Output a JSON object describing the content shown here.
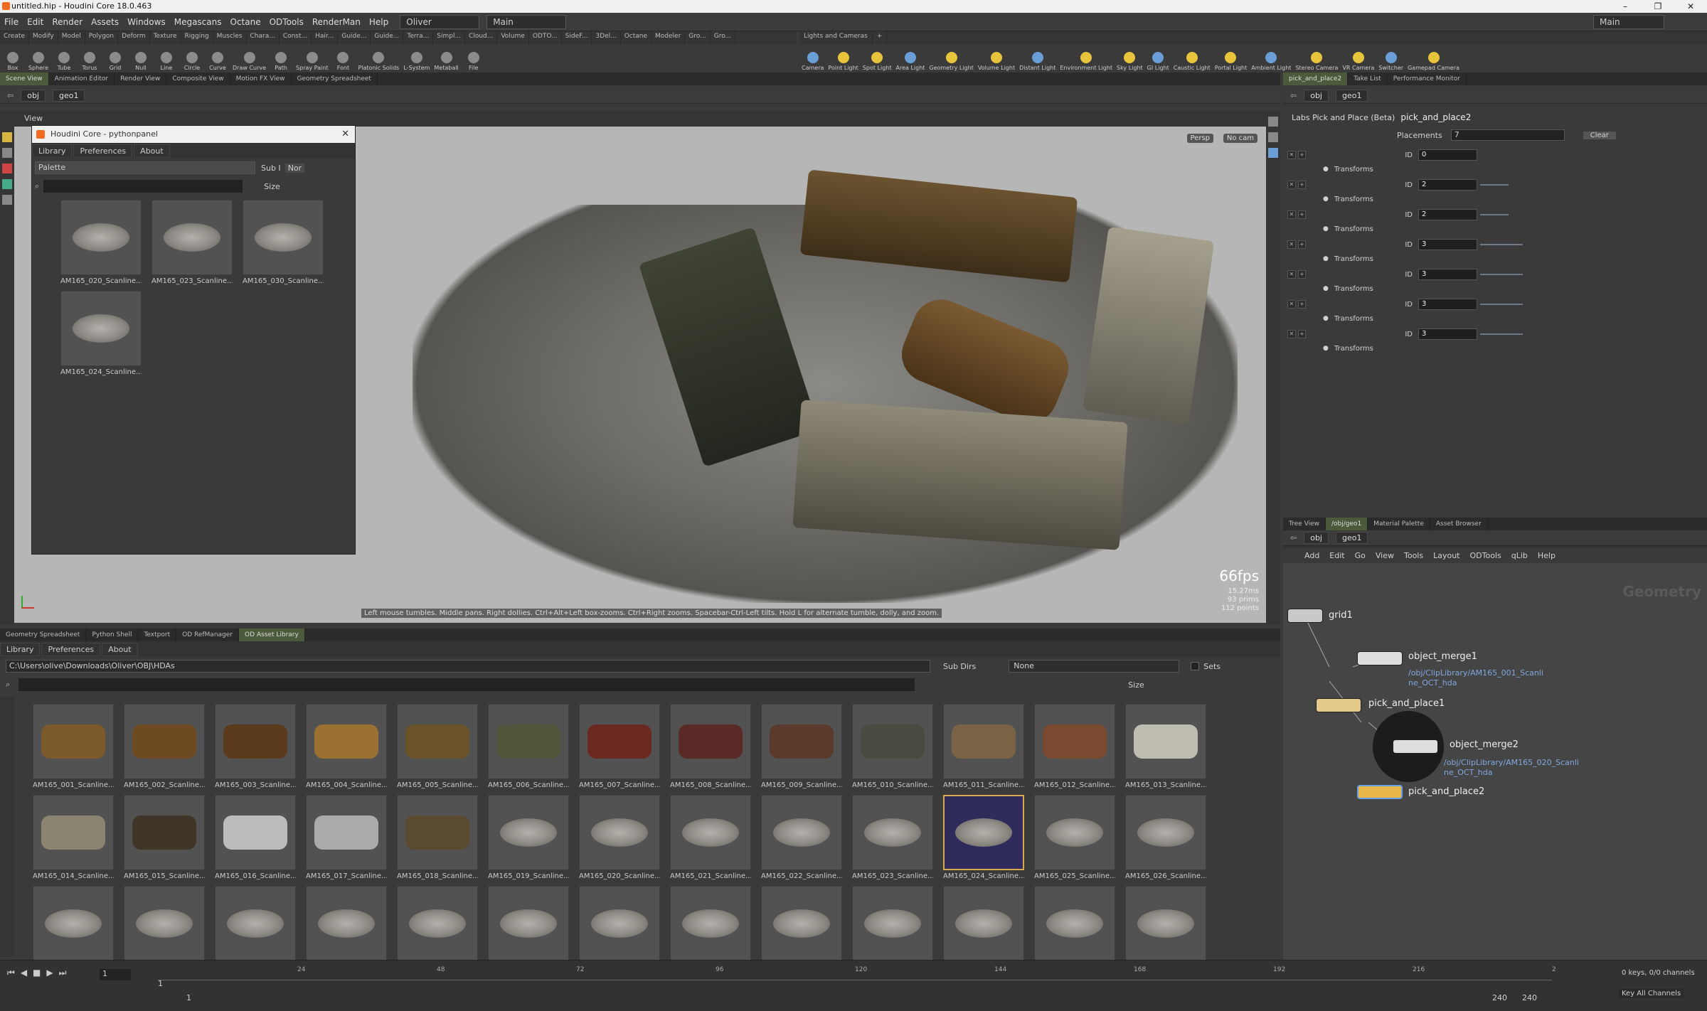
{
  "window": {
    "title": "untitled.hip - Houdini Core 18.0.463",
    "controls": [
      "–",
      "❐",
      "✕"
    ]
  },
  "menubar": {
    "items": [
      "File",
      "Edit",
      "Render",
      "Assets",
      "Windows",
      "Megascans",
      "Octane",
      "ODTools",
      "RenderMan",
      "Help"
    ],
    "desktop": "Oliver",
    "context": "Main",
    "right_context": "Main"
  },
  "shelf_tabs_left": [
    "Create",
    "Modify",
    "Model",
    "Polygon",
    "Deform",
    "Texture",
    "Rigging",
    "Muscles",
    "Chara...",
    "Const...",
    "Hair...",
    "Guide...",
    "Guide...",
    "Terra...",
    "Simpl...",
    "Cloud...",
    "Volume",
    "ODTO...",
    "SideF...",
    "3Del...",
    "Octane",
    "Modeler",
    "Gro...",
    "Gro..."
  ],
  "shelf_tabs_right": [
    "Lights and Cameras"
  ],
  "tools_left": [
    "Box",
    "Sphere",
    "Tube",
    "Torus",
    "Grid",
    "Null",
    "Line",
    "Circle",
    "Curve",
    "Draw Curve",
    "Path",
    "Spray Paint",
    "Font",
    "Platonic Solids",
    "L-System",
    "Metaball",
    "File"
  ],
  "tools_right": [
    "Camera",
    "Point Light",
    "Spot Light",
    "Area Light",
    "Geometry Light",
    "Volume Light",
    "Distant Light",
    "Environment Light",
    "Sky Light",
    "GI Light",
    "Caustic Light",
    "Portal Light",
    "Ambient Light",
    "Stereo Camera",
    "VR Camera",
    "Switcher",
    "Gamepad Camera"
  ],
  "left_pane_tabs": [
    "Scene View",
    "Animation Editor",
    "Render View",
    "Composite View",
    "Motion FX View",
    "Geometry Spreadsheet"
  ],
  "right_top_tabs": [
    "pick_and_place2",
    "Take List",
    "Performance Monitor"
  ],
  "path": {
    "obj": "obj",
    "geo": "geo1"
  },
  "viewport": {
    "label": "View",
    "persp": "Persp",
    "cam": "No cam",
    "fps": "66fps",
    "stats": [
      "15.27ms",
      "93  prims",
      "112  points"
    ],
    "help": "Left mouse tumbles. Middle pans. Right dollies. Ctrl+Alt+Left box-zooms. Ctrl+Right zooms. Spacebar-Ctrl-Left tilts. Hold L for alternate tumble, dolly, and zoom."
  },
  "python_panel": {
    "title": "Houdini Core - pythonpanel",
    "tabs": [
      "Library",
      "Preferences",
      "About"
    ],
    "palette": "Palette",
    "sub_label": "Sub I",
    "none_label": "Nor",
    "size_label": "Size",
    "items": [
      "AM165_020_Scanline...",
      "AM165_023_Scanline...",
      "AM165_030_Scanline...",
      "AM165_024_Scanline..."
    ]
  },
  "params": {
    "node_type": "Labs Pick and Place (Beta)",
    "node_name": "pick_and_place2",
    "placements_label": "Placements",
    "placements_value": "7",
    "clear": "Clear",
    "id_label": "ID",
    "transforms_label": "Transforms",
    "ids": [
      0,
      2,
      2,
      3,
      3,
      3,
      3
    ]
  },
  "network": {
    "tabs": [
      "Tree View",
      "/obj/geo1",
      "Material Palette",
      "Asset Browser"
    ],
    "menu": [
      "Add",
      "Edit",
      "Go",
      "View",
      "Tools",
      "Layout",
      "ODTools",
      "qLib",
      "Help"
    ],
    "watermark": "Geometry",
    "nodes": {
      "grid": "grid1",
      "merge1": "object_merge1",
      "merge1_path": "/obj/ClipLibrary/AM165_001_Scanli\nne_OCT_hda",
      "pp1": "pick_and_place1",
      "merge2": "object_merge2",
      "merge2_path": "/obj/ClipLibrary/AM165_020_Scanli\nne_OCT_hda",
      "pp2": "pick_and_place2"
    }
  },
  "asset_library": {
    "pane_tabs": [
      "Geometry Spreadsheet",
      "Python Shell",
      "Textport",
      "OD RefManager",
      "OD Asset Library"
    ],
    "tabs": [
      "Library",
      "Preferences",
      "About"
    ],
    "path": "C:\\Users\\olive\\Downloads\\Oliver\\OBJ\\HDAs",
    "subdirs_label": "Sub Dirs",
    "subdirs_value": "None",
    "sets_label": "Sets",
    "size_label": "Size",
    "row1": [
      "AM165_001_Scanline...",
      "AM165_002_Scanline...",
      "AM165_003_Scanline...",
      "AM165_004_Scanline...",
      "AM165_005_Scanline...",
      "AM165_006_Scanline...",
      "AM165_007_Scanline...",
      "AM165_008_Scanline...",
      "AM165_009_Scanline...",
      "AM165_010_Scanline...",
      "AM165_011_Scanline...",
      "AM165_012_Scanline...",
      "AM165_013_Scanline..."
    ],
    "row2": [
      "AM165_014_Scanline...",
      "AM165_015_Scanline...",
      "AM165_016_Scanline...",
      "AM165_017_Scanline...",
      "AM165_018_Scanline...",
      "AM165_019_Scanline...",
      "AM165_020_Scanline...",
      "AM165_021_Scanline...",
      "AM165_022_Scanline...",
      "AM165_023_Scanline...",
      "AM165_024_Scanline...",
      "AM165_025_Scanline...",
      "AM165_026_Scanline..."
    ],
    "selected": "AM165_024_Scanline..."
  },
  "timeline": {
    "frame": "1",
    "ticks": [
      "24",
      "48",
      "72",
      "96",
      "120",
      "144",
      "168",
      "192",
      "216",
      "2"
    ],
    "start": "1",
    "start2": "1",
    "end": "240",
    "end2": "240",
    "keys": "0 keys, 0/0 channels",
    "key_all": "Key All Channels"
  }
}
